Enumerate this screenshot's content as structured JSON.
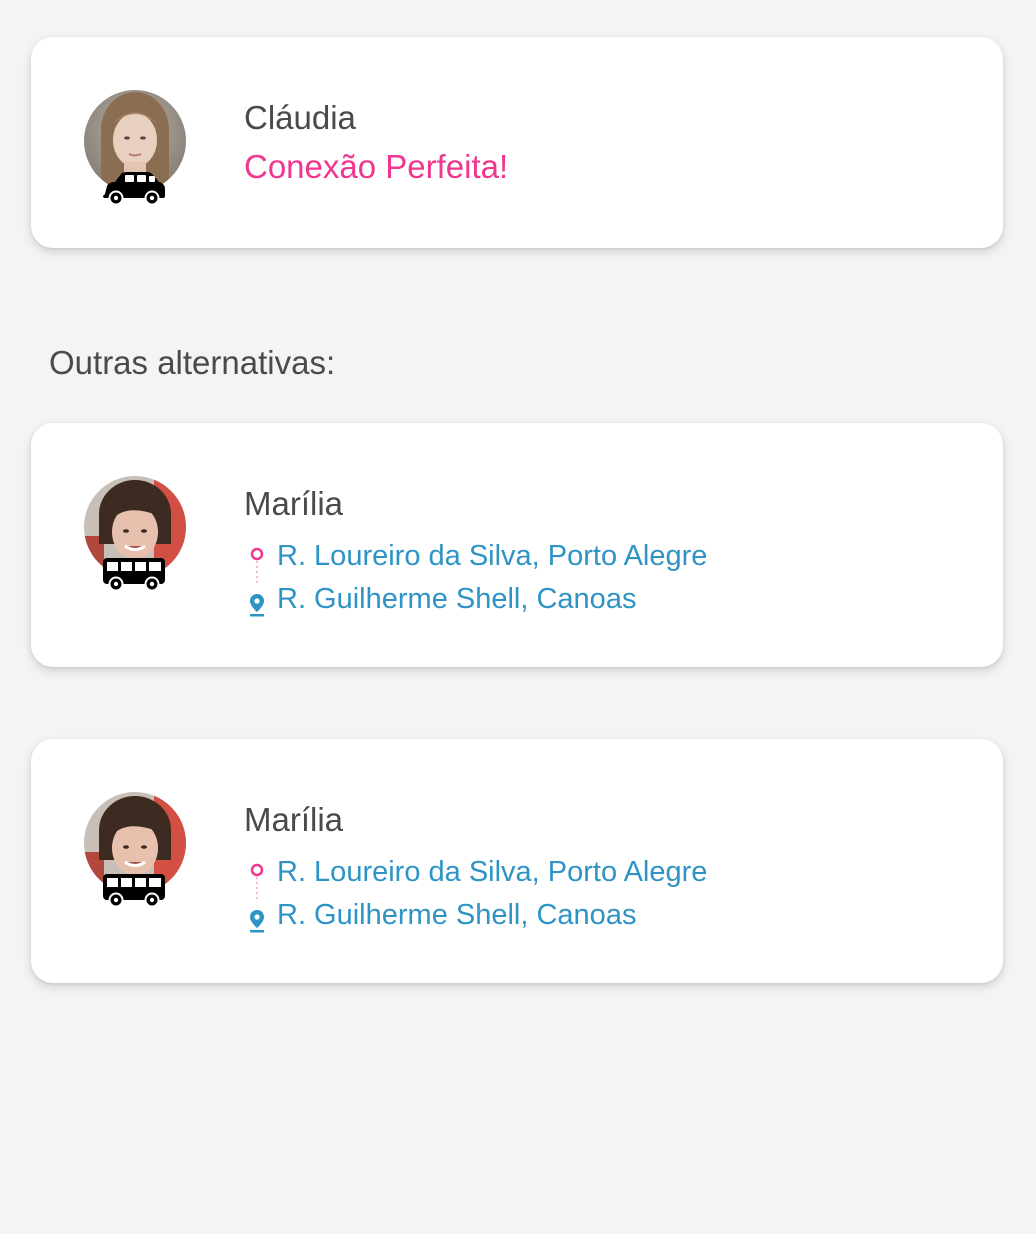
{
  "primary_match": {
    "name": "Cláudia",
    "status": "Conexão Perfeita!",
    "avatar_icon": "avatar-claudia",
    "vehicle_icon": "car-icon"
  },
  "alternatives_heading": "Outras alternativas:",
  "alternatives": [
    {
      "name": "Marília",
      "origin": "R. Loureiro da Silva, Porto Alegre",
      "destination": "R. Guilherme Shell, Canoas",
      "avatar_icon": "avatar-marilia",
      "vehicle_icon": "bus-icon"
    },
    {
      "name": "Marília",
      "origin": "R. Loureiro da Silva, Porto Alegre",
      "destination": "R. Guilherme Shell, Canoas",
      "avatar_icon": "avatar-marilia",
      "vehicle_icon": "bus-icon"
    }
  ],
  "colors": {
    "background": "#f4f4f4",
    "card": "#ffffff",
    "name_text": "#4a4a4a",
    "status_pink": "#f0368f",
    "route_blue": "#2e93c5",
    "origin_pink": "#f0368f"
  }
}
